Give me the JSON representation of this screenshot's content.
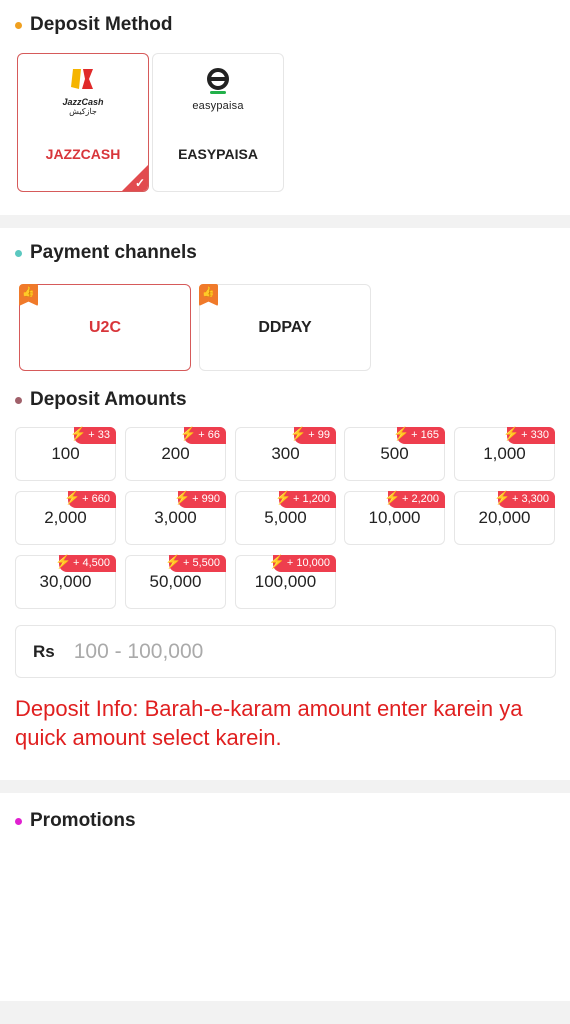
{
  "deposit_method": {
    "title": "Deposit Method",
    "dot_color": "#f0a020",
    "methods": [
      {
        "label": "JAZZCASH",
        "logo_text": "JazzCash",
        "logo_sub": "جازکیش",
        "selected": true
      },
      {
        "label": "EASYPAISA",
        "logo_text": "easypaisa",
        "selected": false
      }
    ]
  },
  "payment_channels": {
    "title": "Payment channels",
    "dot_color": "#5bc8c0",
    "channels": [
      {
        "label": "U2C",
        "selected": true,
        "icon": "thumbs-up-icon"
      },
      {
        "label": "DDPAY",
        "selected": false,
        "icon": "thumbs-up-icon"
      }
    ]
  },
  "deposit_amounts": {
    "title": "Deposit Amounts",
    "dot_color": "#a0606a",
    "chips": [
      {
        "value": "100",
        "bonus": "+ 33"
      },
      {
        "value": "200",
        "bonus": "+ 66"
      },
      {
        "value": "300",
        "bonus": "+ 99"
      },
      {
        "value": "500",
        "bonus": "+ 165"
      },
      {
        "value": "1,000",
        "bonus": "+ 330"
      },
      {
        "value": "2,000",
        "bonus": "+ 660"
      },
      {
        "value": "3,000",
        "bonus": "+ 990"
      },
      {
        "value": "5,000",
        "bonus": "+ 1,200"
      },
      {
        "value": "10,000",
        "bonus": "+ 2,200"
      },
      {
        "value": "20,000",
        "bonus": "+ 3,300"
      },
      {
        "value": "30,000",
        "bonus": "+ 4,500"
      },
      {
        "value": "50,000",
        "bonus": "+ 5,500"
      },
      {
        "value": "100,000",
        "bonus": "+ 10,000"
      }
    ],
    "currency_label": "Rs",
    "input_placeholder": "100 - 100,000",
    "info_text": "Deposit Info: Barah-e-karam amount enter karein ya quick amount select karein."
  },
  "promotions": {
    "title": "Promotions",
    "dot_color": "#e020d0"
  },
  "colors": {
    "accent_red": "#e02020",
    "selected_border": "#d65a5a",
    "badge_red": "#ee3e4e"
  }
}
